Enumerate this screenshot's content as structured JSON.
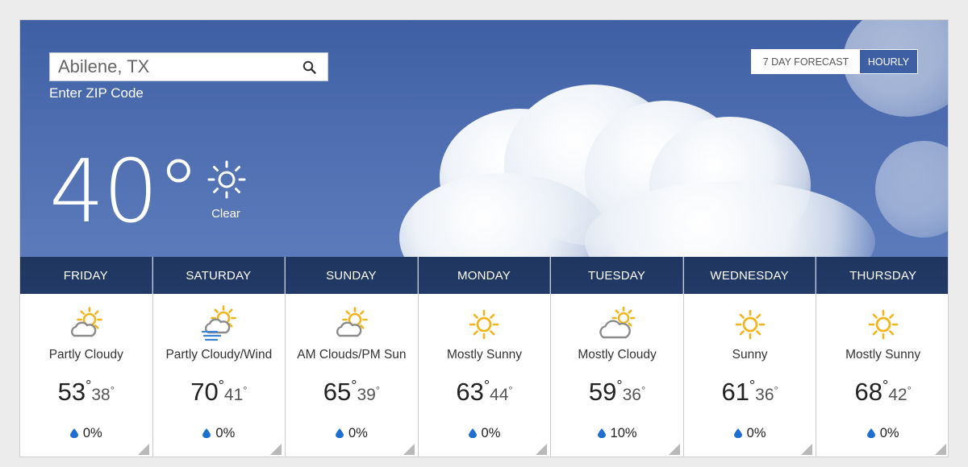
{
  "search": {
    "value": "Abilene, TX",
    "zip_label": "Enter ZIP Code"
  },
  "toggle": {
    "seven_day": "7 DAY FORECAST",
    "hourly": "HOURLY"
  },
  "current": {
    "temp": "40°",
    "condition": "Clear",
    "icon": "sun-icon"
  },
  "colors": {
    "sun": "#f2b51c",
    "cloud": "#8a8a8a",
    "drop": "#1f6fd1",
    "header": "#223a66",
    "sky": "#4d6db0"
  },
  "days": [
    {
      "name": "FRIDAY",
      "icon": "partly-cloudy-icon",
      "condition": "Partly Cloudy",
      "hi": "53",
      "lo": "38",
      "precip": "0%"
    },
    {
      "name": "SATURDAY",
      "icon": "partly-cloudy-wind-icon",
      "condition": "Partly Cloudy/Wind",
      "hi": "70",
      "lo": "41",
      "precip": "0%"
    },
    {
      "name": "SUNDAY",
      "icon": "partly-cloudy-icon",
      "condition": "AM Clouds/PM Sun",
      "hi": "65",
      "lo": "39",
      "precip": "0%"
    },
    {
      "name": "MONDAY",
      "icon": "sun-icon",
      "condition": "Mostly Sunny",
      "hi": "63",
      "lo": "44",
      "precip": "0%"
    },
    {
      "name": "TUESDAY",
      "icon": "mostly-cloudy-icon",
      "condition": "Mostly Cloudy",
      "hi": "59",
      "lo": "36",
      "precip": "10%"
    },
    {
      "name": "WEDNESDAY",
      "icon": "sun-icon",
      "condition": "Sunny",
      "hi": "61",
      "lo": "36",
      "precip": "0%"
    },
    {
      "name": "THURSDAY",
      "icon": "sun-icon",
      "condition": "Mostly Sunny",
      "hi": "68",
      "lo": "42",
      "precip": "0%"
    }
  ]
}
